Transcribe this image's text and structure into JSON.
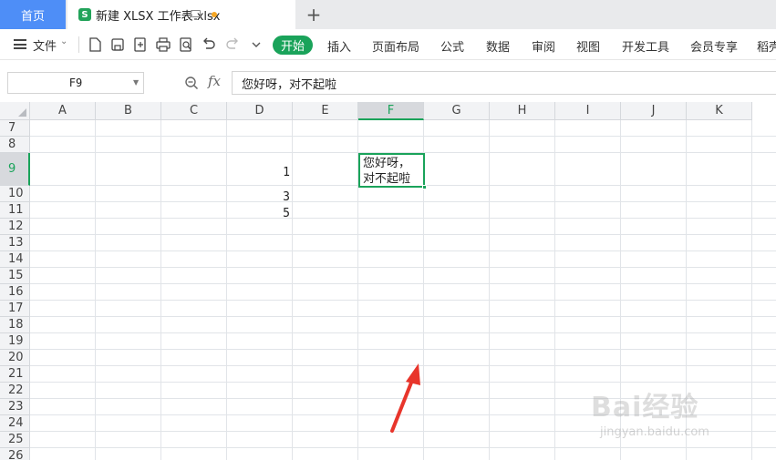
{
  "tabs": {
    "home_label": "首页",
    "doc_icon_text": "S",
    "doc_title": "新建 XLSX 工作表.xlsx",
    "unsaved_color": "#f5a623",
    "add_label": "+"
  },
  "menu": {
    "file_label": "文件",
    "start_label": "开始",
    "items": [
      "插入",
      "页面布局",
      "公式",
      "数据",
      "审阅",
      "视图",
      "开发工具",
      "会员专享",
      "稻壳"
    ],
    "accent": "#1aa35a"
  },
  "formula": {
    "cell_ref": "F9",
    "fx_label": "fx",
    "content": "您好呀，对不起啦"
  },
  "grid": {
    "columns": [
      "A",
      "B",
      "C",
      "D",
      "E",
      "F",
      "G",
      "H",
      "I",
      "J",
      "K"
    ],
    "active_column": "F",
    "rows": [
      "7",
      "8",
      "9",
      "10",
      "11",
      "12",
      "13",
      "14",
      "15",
      "16",
      "17",
      "18",
      "19",
      "20",
      "21",
      "22",
      "23",
      "24",
      "25",
      "26"
    ],
    "active_row": "9",
    "cells": {
      "D9": "1",
      "D10": "3",
      "D11": "5",
      "F9": "您好呀，\n对不起啦"
    }
  },
  "watermark": {
    "brand": "Bai经验",
    "site": "jingyan.baidu.com"
  }
}
